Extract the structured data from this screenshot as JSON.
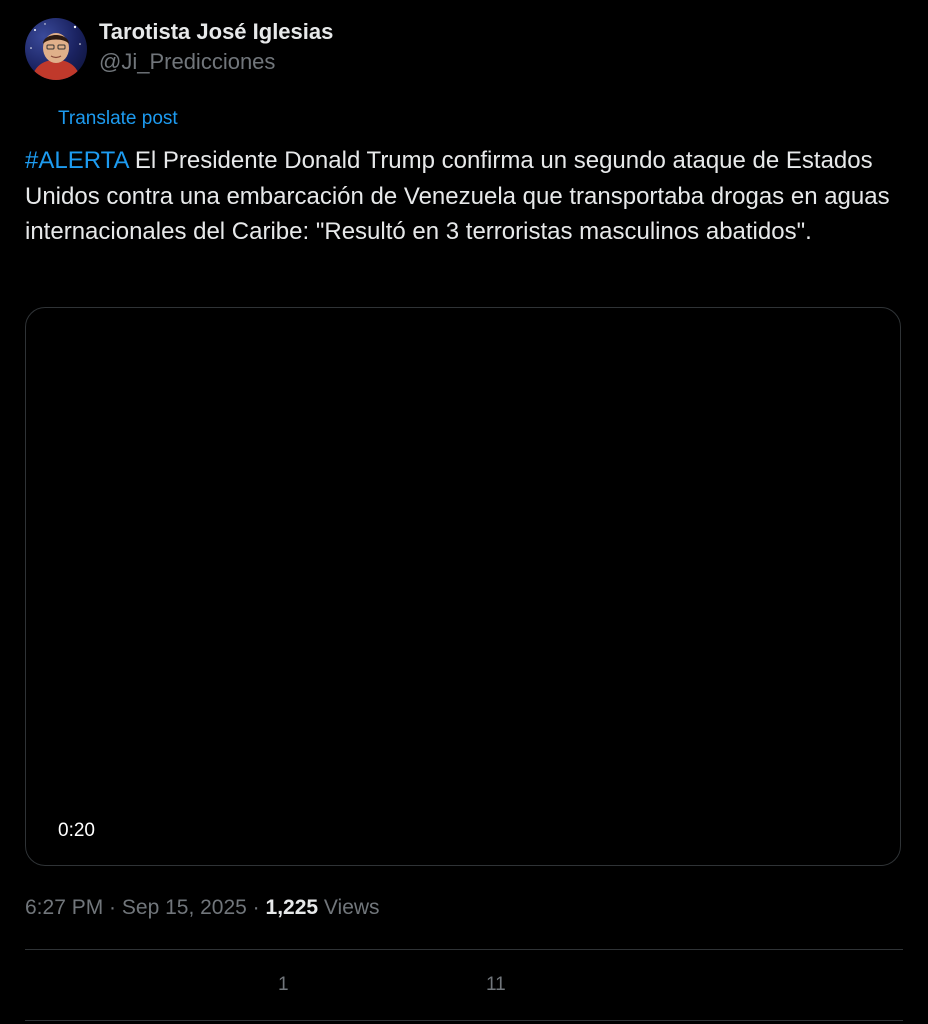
{
  "author": {
    "display_name": "Tarotista José Iglesias",
    "handle": "@Ji_Predicciones"
  },
  "translate_label": "Translate post",
  "post": {
    "hashtag": "#ALERTA",
    "body": " El Presidente Donald Trump confirma un segundo ataque de Estados Unidos contra una embarcación de Venezuela que transportaba drogas en aguas internacionales del Caribe: \"Resultó en 3 terroristas masculinos abatidos\"."
  },
  "video": {
    "duration": "0:20"
  },
  "meta": {
    "time": "6:27 PM",
    "separator": " · ",
    "date": "Sep 15, 2025",
    "separator2": " · ",
    "views_count": "1,225",
    "views_label": " Views"
  },
  "actions": {
    "reply_count": "1",
    "retweet_count": "11"
  },
  "colors": {
    "background": "#000000",
    "text": "#e7e9ea",
    "secondary": "#71767b",
    "accent": "#1d9bf0",
    "border": "#2f3336"
  }
}
